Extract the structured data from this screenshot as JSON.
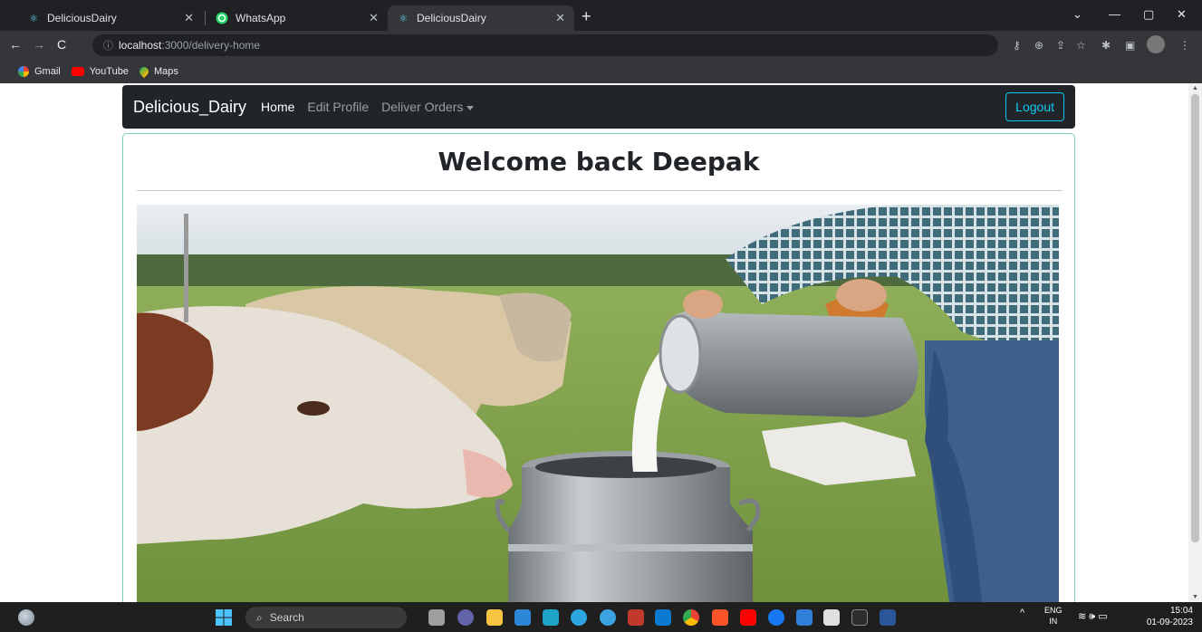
{
  "browser": {
    "tabs": [
      {
        "title": "DeliciousDairy",
        "icon": "react-icon"
      },
      {
        "title": "WhatsApp",
        "icon": "whatsapp-icon"
      },
      {
        "title": "DeliciousDairy",
        "icon": "react-icon"
      }
    ],
    "url_host": "localhost",
    "url_path": ":3000/delivery-home",
    "bookmarks": [
      "Gmail",
      "YouTube",
      "Maps"
    ]
  },
  "app": {
    "brand": "Delicious_Dairy",
    "nav": {
      "home": "Home",
      "edit_profile": "Edit Profile",
      "deliver_orders": "Deliver Orders"
    },
    "logout": "Logout",
    "welcome": "Welcome back Deepak",
    "colors": {
      "navbar": "#212529",
      "logout_border": "#0dcaf0",
      "card_border": "#7fd1b0"
    }
  },
  "taskbar": {
    "search_placeholder": "Search",
    "lang_top": "ENG",
    "lang_bottom": "IN",
    "time": "15:04",
    "date": "01-09-2023"
  }
}
